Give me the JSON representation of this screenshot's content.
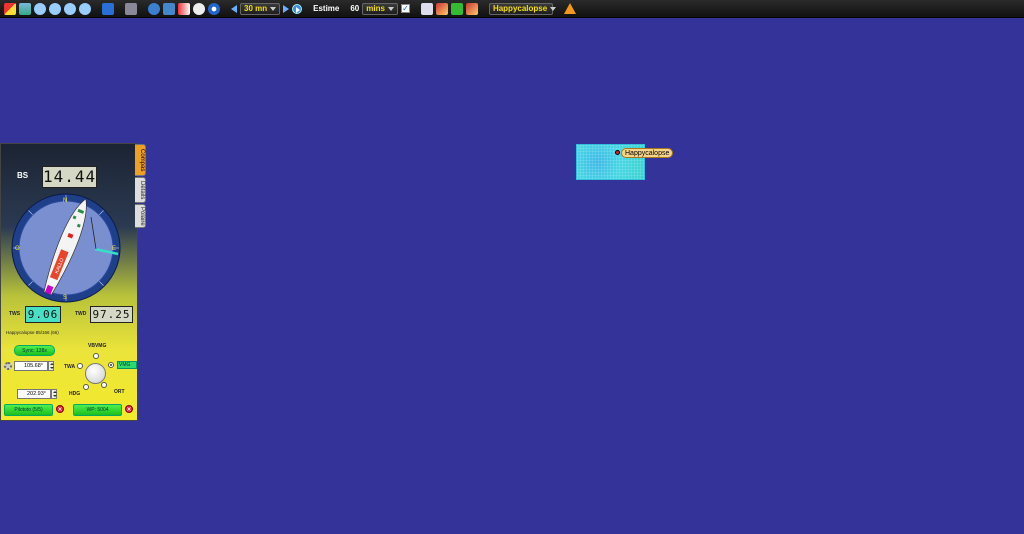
{
  "toolbar": {
    "interval": "30 mn",
    "estime_label": "Estime",
    "estime_value": "60",
    "estime_unit": "mins",
    "boat_select": "Happycalopse"
  },
  "map": {
    "background": "#333399",
    "boat_label": "Happycalopse"
  },
  "panel": {
    "tabs": [
      "Compas",
      "Détails",
      "Polaire"
    ],
    "bs_label": "BS",
    "bs_value": "14.44",
    "tws_label": "TWS",
    "tws_value": "9.06",
    "twd_label": "TWD",
    "twd_value": "97.25",
    "boat_info": "Happycalopse 85/166 (66)",
    "sync_button": "Sync: 138s",
    "vbvmg_label": "VBVMG",
    "twa_label": "TWA",
    "twa_value": "105.68°",
    "vmg_label": "VMG",
    "hdg_label": "HDG",
    "hdg_value": "202.93°",
    "ort_label": "ORT",
    "pilototo_button": "Pilototo (5/5)",
    "wp_button": "WP: 5004",
    "compass_letters": {
      "n": "N",
      "s": "S",
      "e": "E",
      "w": "O"
    },
    "boat_name_on_hull": "KALLO"
  }
}
